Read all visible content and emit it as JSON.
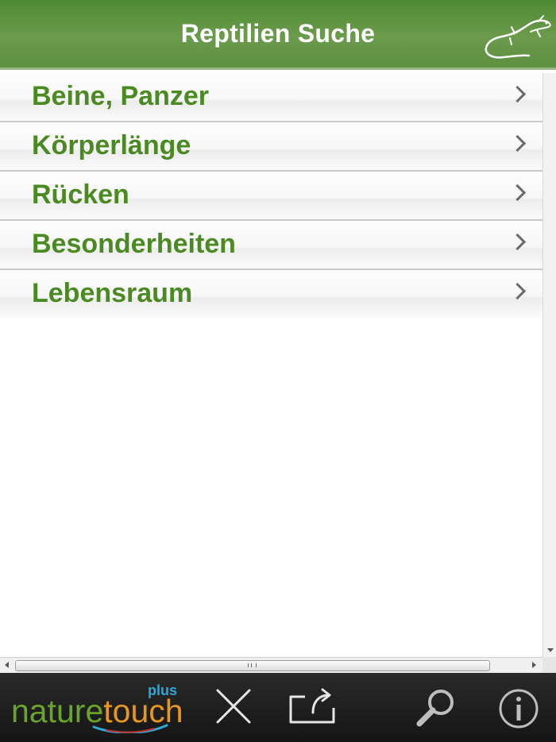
{
  "header": {
    "title": "Reptilien Suche"
  },
  "list": {
    "items": [
      {
        "label": "Beine, Panzer"
      },
      {
        "label": "Körperlänge"
      },
      {
        "label": "Rücken"
      },
      {
        "label": "Besonderheiten"
      },
      {
        "label": "Lebensraum"
      }
    ]
  },
  "toolbar": {
    "logo": {
      "nature": "nature",
      "touch": "touch",
      "plus": "plus"
    },
    "icons": [
      "close-icon",
      "share-icon",
      "search-icon",
      "info-icon"
    ]
  },
  "colors": {
    "header_green": "#6b9b4c",
    "item_text_green": "#4b8a22",
    "toolbar_bg": "#1e1e1e",
    "logo_green": "#6aa42a",
    "logo_orange": "#e8961e",
    "logo_blue": "#2fa8d8"
  }
}
